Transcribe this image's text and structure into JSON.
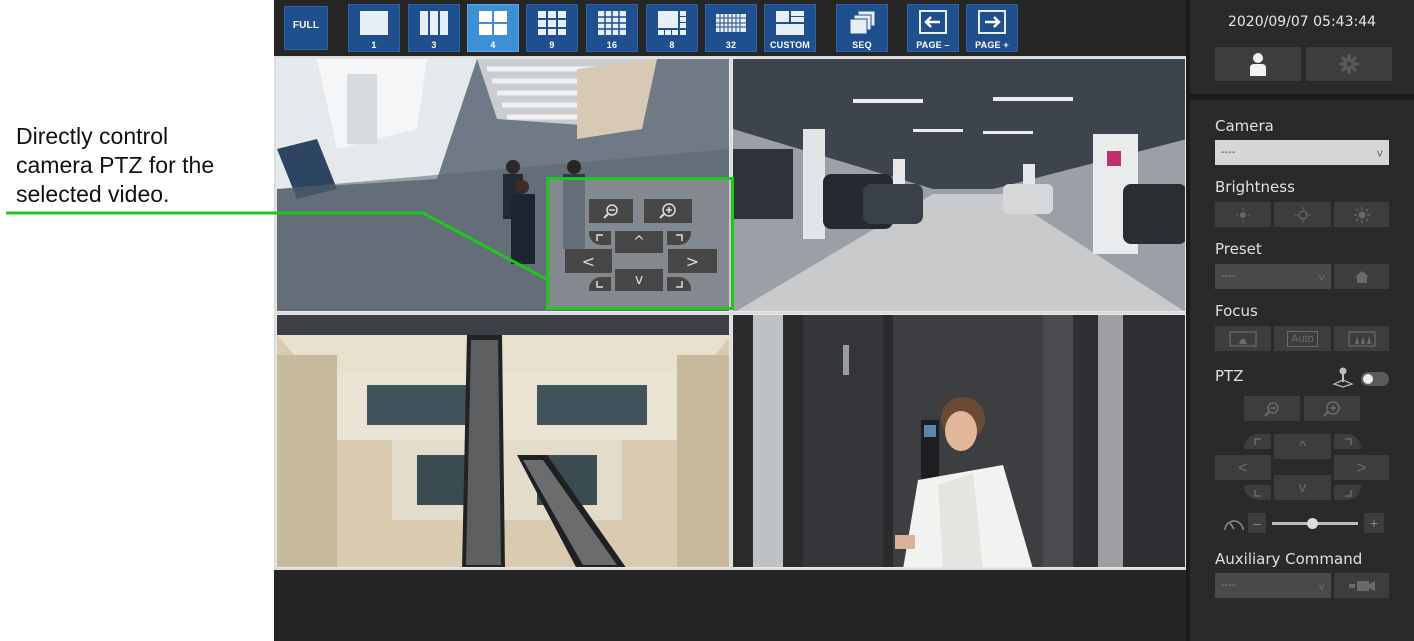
{
  "annotation": {
    "lines": [
      "Directly control",
      "camera PTZ for the",
      "selected video."
    ],
    "line_color": "#1ec71e"
  },
  "toolbar": {
    "full_label": "FULL",
    "layout_buttons": [
      "1",
      "3",
      "4",
      "9",
      "16",
      "8",
      "32",
      "CUSTOM"
    ],
    "active_layout": "4",
    "seq_label": "SEQ",
    "page_prev_label": "PAGE –",
    "page_next_label": "PAGE +"
  },
  "video_tiles": [
    {
      "scene": "office-atrium-meeting",
      "selected": true
    },
    {
      "scene": "parking-garage"
    },
    {
      "scene": "escalator-atrium"
    },
    {
      "scene": "woman-phone-doorway"
    }
  ],
  "ptz_overlay": {
    "zoom_out_icon": "zoom-out-icon",
    "zoom_in_icon": "zoom-in-icon",
    "up": "^",
    "down": "v",
    "left": "<",
    "right": ">"
  },
  "sidebar": {
    "datetime": "2020/09/07 05:43:44",
    "camera_label": "Camera",
    "camera_value": "----",
    "brightness_label": "Brightness",
    "preset_label": "Preset",
    "preset_value": "----",
    "focus_label": "Focus",
    "focus_auto": "Auto",
    "ptz_label": "PTZ",
    "ptz_up": "^",
    "ptz_down": "v",
    "ptz_left": "<",
    "ptz_right": ">",
    "speed_minus": "–",
    "speed_plus": "+",
    "aux_label": "Auxiliary Command",
    "aux_value": "----"
  },
  "colors": {
    "toolbar_button": "#1f4f8c",
    "toolbar_active": "#3d8fd6",
    "highlight_green": "#1ec71e",
    "app_background": "#242424"
  }
}
